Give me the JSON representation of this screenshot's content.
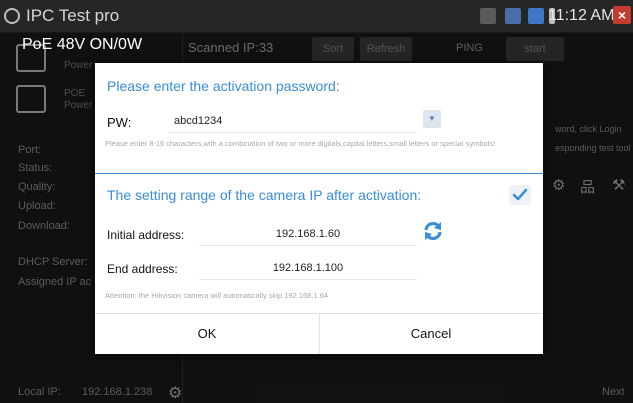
{
  "app": {
    "title": "IPC Test pro",
    "clock": "11:12 AM"
  },
  "left_panel": {
    "poe_toggle_label": "PoE 48V ON/0W",
    "device_1_caption": "Power",
    "device_2_caption": "POE",
    "device_2_subcaption": "Power",
    "port_label": "Port:",
    "status_label": "Status:",
    "quality_label": "Quality:",
    "upload_label": "Upload:",
    "download_label": "Download:",
    "dhcp_label": "DHCP Server:",
    "assigned_label": "Assigned IP ac",
    "local_ip_label": "Local IP:",
    "local_ip_value": "192.168.1.238"
  },
  "right_panel": {
    "scanned_text": "Scanned IP:33",
    "sort_label": "Sort",
    "refresh_label": "Refresh",
    "ping_label": "PING",
    "start_label": "start",
    "hint_1": "word, click Login",
    "hint_2": "esponding test tool",
    "next_label": "Next"
  },
  "dialog": {
    "title": "Please enter the activation password:",
    "pw_label": "PW:",
    "pw_value": "abcd1234",
    "pw_hint": "Please enter 8-16 characters,with a combination of two or more digitals,capital letters,small letters or special symbols!",
    "range_title": "The setting range of the camera IP after activation:",
    "range_checked": true,
    "initial_label": "Initial address:",
    "initial_value": "192.168.1.60",
    "end_label": "End address:",
    "end_value": "192.168.1.100",
    "note": "Attention: the Hikvision camera will automatically skip 192.168.1.64",
    "ok_label": "OK",
    "cancel_label": "Cancel"
  },
  "colors": {
    "accent": "#3a8dd8",
    "close_red": "#c43b2f"
  }
}
